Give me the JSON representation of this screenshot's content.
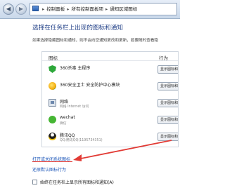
{
  "address_bar": {
    "crumbs": [
      "控制面板",
      "所有控制面板项",
      "通知区域图标"
    ]
  },
  "heading": "选择在任务栏上出现的图标和通知",
  "description": "如果选择隐藏图标和通知，则不会向您通知更改和更新，若要随时查看隐",
  "table": {
    "col_icon": "图标",
    "col_action": "行为",
    "rows": [
      {
        "icon": "shield-icon",
        "name": "360杀毒 主程序",
        "sub": "",
        "action": "显示图标和通知"
      },
      {
        "icon": "guard-icon",
        "name": "360安全卫士 安全防护中心模块",
        "sub": "",
        "action": "显示图标和通知"
      },
      {
        "icon": "network-icon",
        "name": "网络",
        "sub": "网络 Internet 访问",
        "action": "显示图标和通知"
      },
      {
        "icon": "wechat-icon",
        "name": "wechat",
        "sub": "微信",
        "action": "显示图标和通知"
      },
      {
        "icon": "qq-icon",
        "name": "腾讯QQ",
        "sub": "QQ:腾讯QQ(1195734351)",
        "action": "显示图标和通知"
      }
    ]
  },
  "links": {
    "open_system_icons": "打开或关闭系统图标",
    "restore_default": "还原默认图标行为"
  },
  "checkbox": {
    "label": "始终在任务栏上显示所有图标和通知(A)",
    "checked": false
  },
  "colors": {
    "heading": "#1f3e86",
    "link": "#1a55b8",
    "annotation": "#e23b35"
  }
}
